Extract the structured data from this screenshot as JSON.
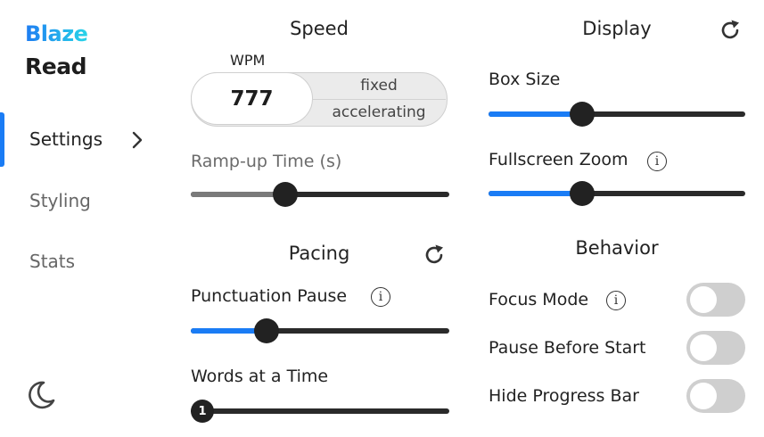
{
  "brand": {
    "line1": "Blaze",
    "line2": "Read"
  },
  "nav": {
    "items": [
      {
        "label": "Settings",
        "active": true
      },
      {
        "label": "Styling",
        "active": false
      },
      {
        "label": "Stats",
        "active": false
      }
    ],
    "theme_icon": "moon-icon"
  },
  "speed": {
    "heading": "Speed",
    "wpm_label": "WPM",
    "wpm_value": "777",
    "modes": [
      "fixed",
      "accelerating"
    ],
    "ramp_label": "Ramp-up Time (s)",
    "ramp_level": 0.35
  },
  "pacing": {
    "heading": "Pacing",
    "punctuation_label": "Punctuation Pause",
    "punctuation_level": 0.27,
    "words_label": "Words at a Time",
    "words_value": "1",
    "words_level": 0.0
  },
  "display": {
    "heading": "Display",
    "box_size_label": "Box Size",
    "box_size_level": 0.35,
    "zoom_label": "Fullscreen Zoom",
    "zoom_level": 0.35
  },
  "behavior": {
    "heading": "Behavior",
    "toggles": [
      {
        "label": "Focus Mode",
        "on": false,
        "info": true
      },
      {
        "label": "Pause Before Start",
        "on": false,
        "info": false
      },
      {
        "label": "Hide Progress Bar",
        "on": false,
        "info": false
      }
    ]
  },
  "colors": {
    "accent": "#1a7cf5",
    "track": "#2a2a2a",
    "toggle_off": "#cfcfcf"
  }
}
